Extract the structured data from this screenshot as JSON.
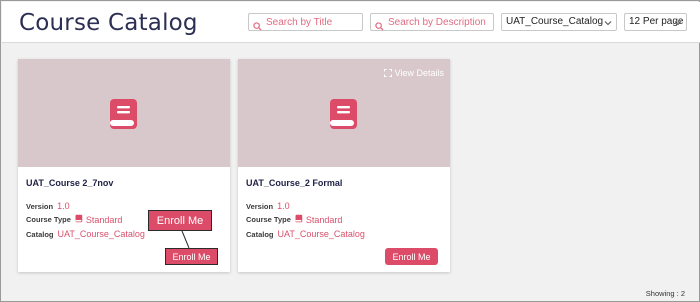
{
  "header": {
    "title": "Course Catalog",
    "search_title_placeholder": "Search by Title",
    "search_description_placeholder": "Search by Description",
    "catalog_select": "UAT_Course_Catalog",
    "per_page_select": "12 Per page"
  },
  "cards": [
    {
      "title": "UAT_Course 2_7nov",
      "version_label": "Version",
      "version": "1.0",
      "type_label": "Course Type",
      "type": "Standard",
      "catalog_label": "Catalog",
      "catalog": "UAT_Course_Catalog",
      "enroll_label": "Enroll Me"
    },
    {
      "title": "UAT_Course_2 Formal",
      "view_details": "View Details",
      "version_label": "Version",
      "version": "1.0",
      "type_label": "Course Type",
      "type": "Standard",
      "catalog_label": "Catalog",
      "catalog": "UAT_Course_Catalog",
      "enroll_label": "Enroll Me"
    }
  ],
  "callout_label": "Enroll Me",
  "footer": {
    "showing": "Showing : 2"
  },
  "colors": {
    "accent": "#dc4c69",
    "title": "#2c2f54",
    "thumb_bg": "#d8c8cc"
  },
  "icons": [
    "search-icon",
    "chevron-down-icon",
    "book-icon",
    "expand-icon"
  ]
}
